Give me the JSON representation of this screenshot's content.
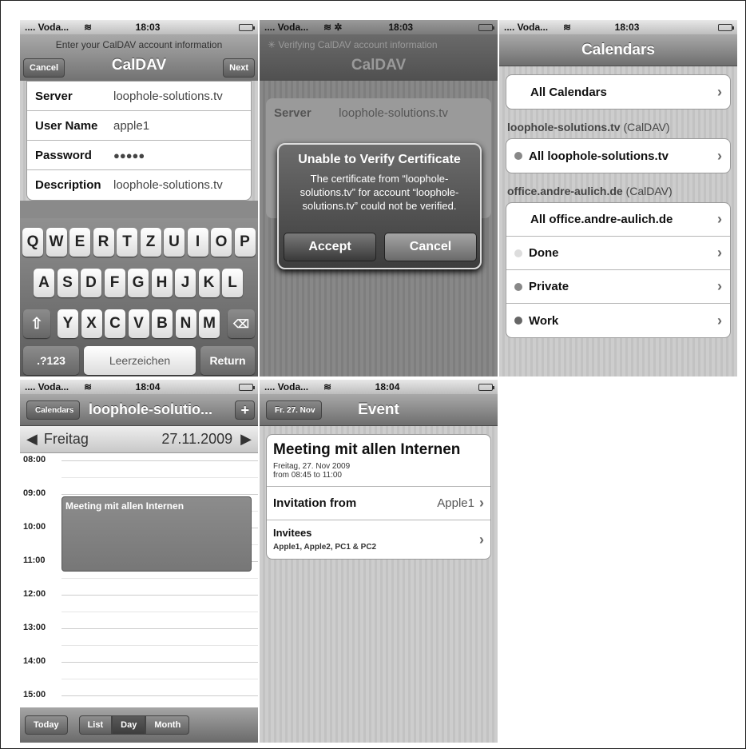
{
  "status": [
    {
      "carrier": ".... Voda...",
      "time": "18:03"
    },
    {
      "carrier": ".... Voda...",
      "time": "18:03"
    },
    {
      "carrier": ".... Voda...",
      "time": "18:03"
    },
    {
      "carrier": ".... Voda...",
      "time": "18:04"
    },
    {
      "carrier": ".... Voda...",
      "time": "18:04"
    }
  ],
  "s1": {
    "prompt": "Enter your CalDAV account information",
    "title": "CalDAV",
    "cancel": "Cancel",
    "next": "Next",
    "fields": [
      {
        "label": "Server",
        "value": "loophole-solutions.tv"
      },
      {
        "label": "User Name",
        "value": "apple1"
      },
      {
        "label": "Password",
        "value": "●●●●●"
      },
      {
        "label": "Description",
        "value": "loophole-solutions.tv"
      }
    ],
    "keys_row1": [
      "Q",
      "W",
      "E",
      "R",
      "T",
      "Z",
      "U",
      "I",
      "O",
      "P"
    ],
    "keys_row2": [
      "A",
      "S",
      "D",
      "F",
      "G",
      "H",
      "J",
      "K",
      "L"
    ],
    "keys_row3": [
      "Y",
      "X",
      "C",
      "V",
      "B",
      "N",
      "M"
    ],
    "k123": ".?123",
    "space": "Leerzeichen",
    "ret": "Return"
  },
  "s2": {
    "prompt": "Verifying CalDAV account information",
    "title": "CalDAV",
    "server_label": "Server",
    "server_value": "loophole-solutions.tv",
    "alert_title": "Unable to Verify Certificate",
    "alert_msg": "The certificate from “loophole-solutions.tv” for account “loophole-solutions.tv” could not be verified.",
    "accept": "Accept",
    "cancel": "Cancel"
  },
  "s3": {
    "title": "Calendars",
    "all": "All Calendars",
    "h1": "loophole-solutions.tv",
    "h1b": "(CalDAV)",
    "c1": "All loophole-solutions.tv",
    "h2": "office.andre-aulich.de",
    "h2b": "(CalDAV)",
    "items": [
      "All office.andre-aulich.de",
      "Done",
      "Private",
      "Work"
    ]
  },
  "s4": {
    "back": "Calendars",
    "title": "loophole-solutio...",
    "plus": "+",
    "day": "Freitag",
    "date": "27.11.2009",
    "hours": [
      "08:00",
      "09:00",
      "10:00",
      "11:00",
      "12:00",
      "13:00",
      "14:00",
      "15:00"
    ],
    "event": "Meeting mit allen Internen",
    "today": "Today",
    "list": "List",
    "dayb": "Day",
    "month": "Month"
  },
  "s5": {
    "back": "Fr. 27. Nov",
    "title": "Event",
    "ev_title": "Meeting mit allen Internen",
    "ev_date": "Freitag, 27. Nov 2009",
    "ev_time": "from 08:45 to 11:00",
    "inv_label": "Invitation from",
    "inv_value": "Apple1",
    "invitees_label": "Invitees",
    "invitees_value": "Apple1, Apple2, PC1 & PC2"
  },
  "colors": {
    "dot_gray": "#888888",
    "dot_light": "#dddddd",
    "dot_dark": "#666666"
  }
}
